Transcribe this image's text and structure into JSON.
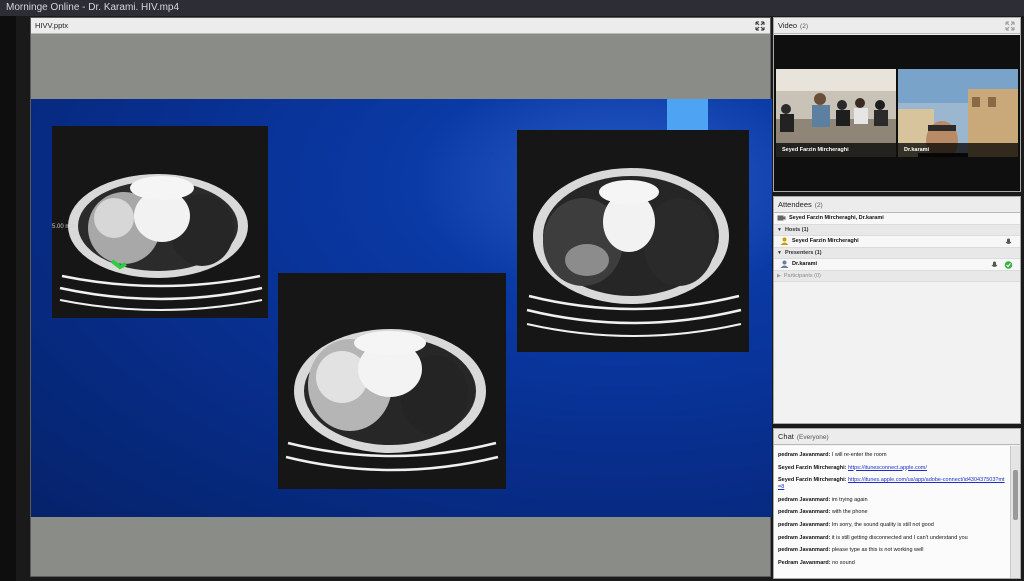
{
  "window": {
    "title": "Morninge Online - Dr. Karami. HIV.mp4"
  },
  "share_pod": {
    "title": "HIVV.pptx",
    "ct_labels": [
      "5.00 mm"
    ]
  },
  "video_pod": {
    "title": "Video",
    "count": "(2)",
    "tiles": [
      {
        "name": "Seyed Farzin Mircheraghi"
      },
      {
        "name": "Dr.karami"
      }
    ]
  },
  "attendees_pod": {
    "title": "Attendees",
    "count": "(2)",
    "summary": "Seyed Farzin Mircheraghi, Dr.karami",
    "groups": {
      "hosts": {
        "label": "Hosts (1)",
        "members": [
          "Seyed Farzin Mircheraghi"
        ]
      },
      "presenters": {
        "label": "Presenters (1)",
        "members": [
          "Dr.karami"
        ]
      },
      "participants": {
        "label": "Participants (0)"
      }
    }
  },
  "chat_pod": {
    "title": "Chat",
    "audience": "(Everyone)",
    "messages": [
      {
        "sender": "pedram Javanmard:",
        "text": "I will re-enter the room"
      },
      {
        "sender": "Seyed Farzin Mircheraghi:",
        "text": "https://itunesconnect.apple.com/",
        "link": true
      },
      {
        "sender": "Seyed Farzin Mircheraghi:",
        "text": "https://itunes.apple.com/us/app/adobe-connect/id430437503?mt=8",
        "link": true
      },
      {
        "sender": "pedram Javanmard:",
        "text": "im trying again"
      },
      {
        "sender": "pedram Javanmard:",
        "text": "with the phone"
      },
      {
        "sender": "pedram Javanmard:",
        "text": "Im sorry, the sound quality is still not good"
      },
      {
        "sender": "pedram Javanmard:",
        "text": "it is still getting disconnected and I can't understand you"
      },
      {
        "sender": "pedram Javanmard:",
        "text": "please type as this is not working well"
      },
      {
        "sender": "Pedram Javanmard:",
        "text": "no sound"
      }
    ]
  },
  "colors": {
    "slide_blue": "#0a3aa6",
    "slide_accent": "#4ea3f2",
    "link": "#1a2fc8",
    "status_green": "#3cb043"
  },
  "icons": [
    "expand-icon",
    "camera-icon",
    "user-icon",
    "host-icon",
    "mic-icon",
    "check-icon"
  ]
}
